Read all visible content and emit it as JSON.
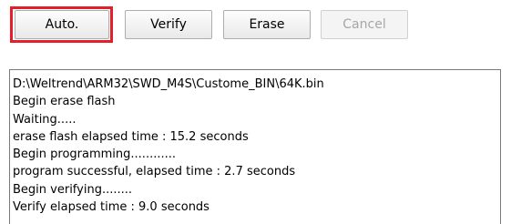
{
  "toolbar": {
    "auto_label": "Auto.",
    "verify_label": "Verify",
    "erase_label": "Erase",
    "cancel_label": "Cancel",
    "cancel_enabled": false
  },
  "log": {
    "lines": [
      "D:\\Weltrend\\ARM32\\SWD_M4S\\Custome_BIN\\64K.bin",
      "Begin erase flash",
      "Waiting.....",
      "erase flash elapsed time : 15.2 seconds",
      "Begin programming............",
      "program successful, elapsed time : 2.7 seconds",
      "Begin verifying........",
      "Verify elapsed time : 9.0 seconds"
    ]
  },
  "colors": {
    "highlight": "#e3202a",
    "disabled_text": "#a6a6a6"
  }
}
